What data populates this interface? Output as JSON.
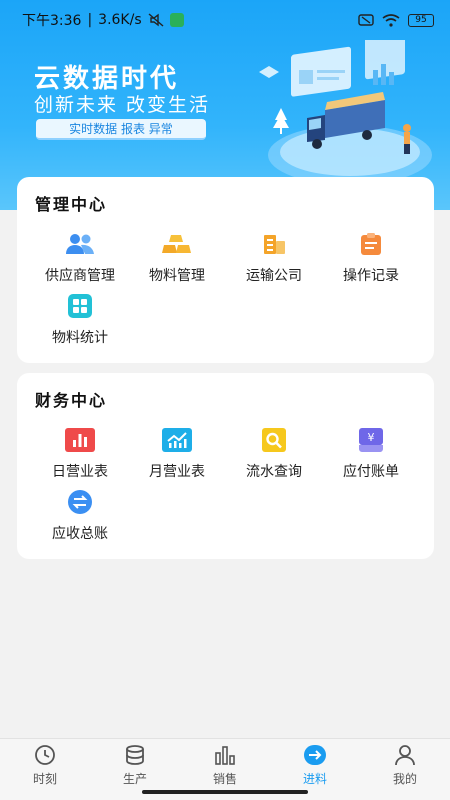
{
  "status": {
    "time": "下午3:36",
    "speed": "3.6K/s",
    "battery": "95"
  },
  "banner": {
    "title": "云数据时代",
    "subtitle": "创新未来  改变生活",
    "tag": "实时数据  报表  异常"
  },
  "management": {
    "title": "管理中心",
    "items": [
      {
        "label": "供应商管理",
        "icon": "people-icon"
      },
      {
        "label": "物料管理",
        "icon": "gold-bars-icon"
      },
      {
        "label": "运输公司",
        "icon": "building-icon"
      },
      {
        "label": "操作记录",
        "icon": "clipboard-icon"
      },
      {
        "label": "物料统计",
        "icon": "grid-icon"
      }
    ]
  },
  "finance": {
    "title": "财务中心",
    "items": [
      {
        "label": "日营业表",
        "icon": "bar-chart-icon"
      },
      {
        "label": "月营业表",
        "icon": "trend-chart-icon"
      },
      {
        "label": "流水查询",
        "icon": "search-doc-icon"
      },
      {
        "label": "应付账单",
        "icon": "yen-tray-icon"
      },
      {
        "label": "应收总账",
        "icon": "exchange-icon"
      }
    ]
  },
  "tabs": [
    {
      "label": "时刻",
      "icon": "clock-icon"
    },
    {
      "label": "生产",
      "icon": "database-icon"
    },
    {
      "label": "销售",
      "icon": "bar-icon"
    },
    {
      "label": "进料",
      "icon": "arrow-circle-icon",
      "active": true
    },
    {
      "label": "我的",
      "icon": "user-icon"
    }
  ],
  "colors": {
    "accent": "#1a9cf0",
    "banner": "#1ba5f8"
  }
}
